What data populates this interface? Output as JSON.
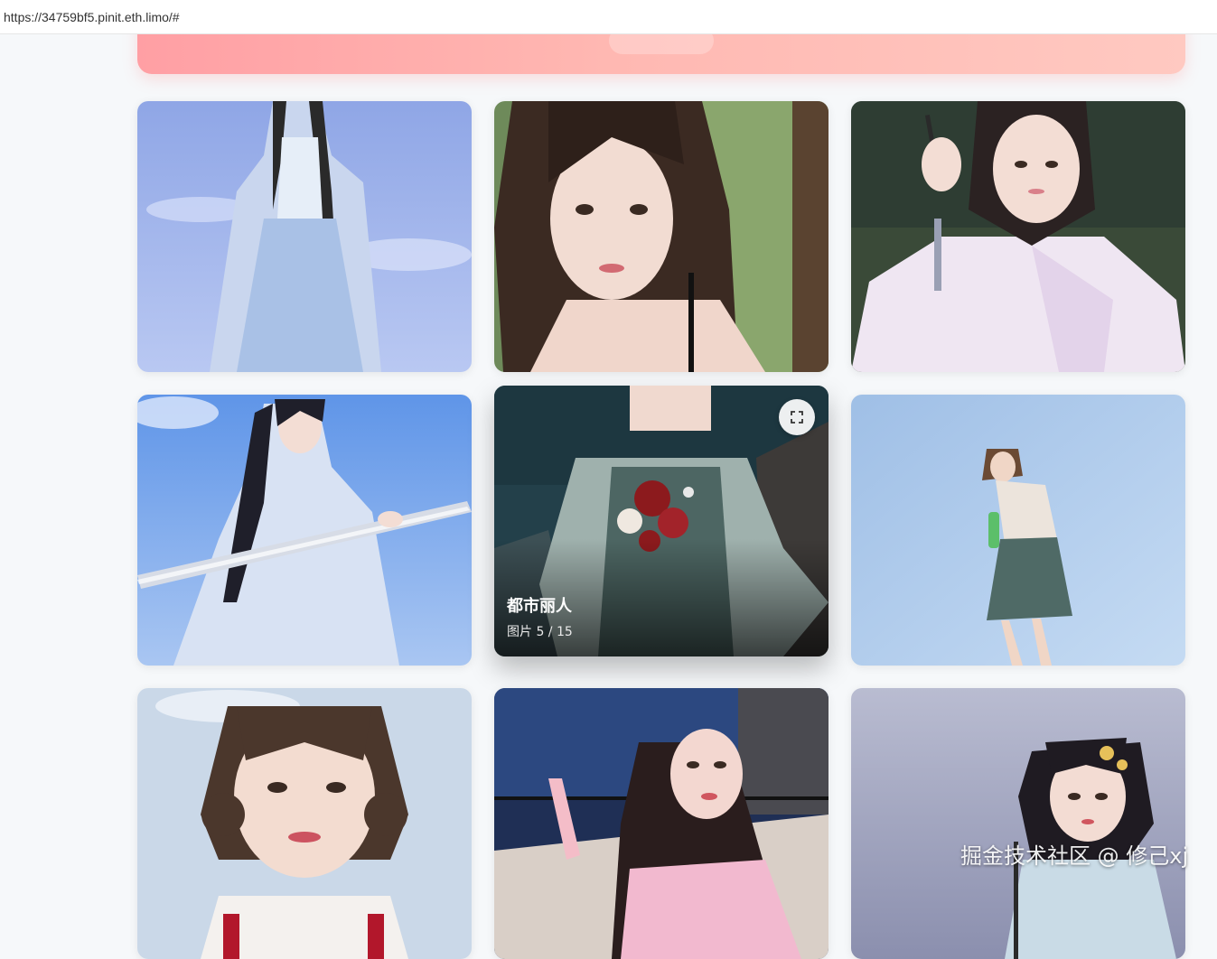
{
  "browser": {
    "url": "https://34759bf5.pinit.eth.limo/#"
  },
  "gallery": {
    "active_card": {
      "title": "都市丽人",
      "counter": "图片 5 / 15"
    }
  },
  "icons": {
    "expand": "fullscreen-icon"
  },
  "watermark": "掘金技术社区 @ 修己xj"
}
